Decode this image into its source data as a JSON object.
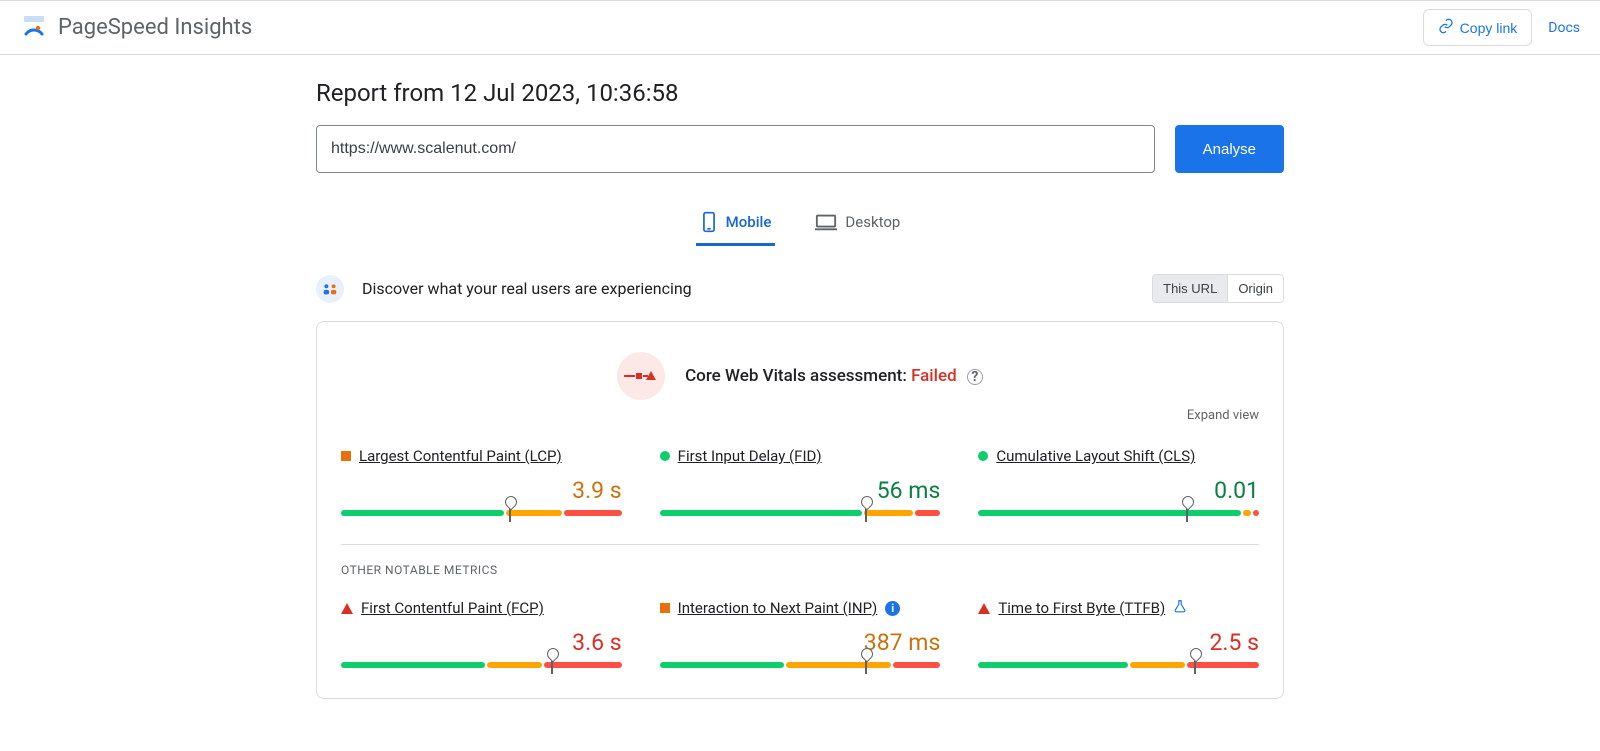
{
  "header": {
    "app_title": "PageSpeed Insights",
    "copy_link": "Copy link",
    "docs": "Docs"
  },
  "report": {
    "title": "Report from 12 Jul 2023, 10:36:58",
    "url_value": "https://www.scalenut.com/",
    "analyse_label": "Analyse"
  },
  "tabs": {
    "mobile": "Mobile",
    "desktop": "Desktop"
  },
  "discover": {
    "text": "Discover what your real users are experiencing",
    "this_url": "This URL",
    "origin": "Origin"
  },
  "assessment": {
    "label": "Core Web Vitals assessment: ",
    "status": "Failed",
    "expand": "Expand view"
  },
  "other_label": "OTHER NOTABLE METRICS",
  "metrics": {
    "lcp": {
      "name": "Largest Contentful Paint (LCP)",
      "value": "3.9 s",
      "marker": "square-orange",
      "color": "orange",
      "bars": [
        59,
        20,
        21
      ],
      "pointer": 60
    },
    "fid": {
      "name": "First Input Delay (FID)",
      "value": "56 ms",
      "marker": "circle-green",
      "color": "green",
      "bars": [
        73,
        18,
        9
      ],
      "pointer": 73
    },
    "cls": {
      "name": "Cumulative Layout Shift (CLS)",
      "value": "0.01",
      "marker": "circle-green",
      "color": "green",
      "bars": [
        95,
        3,
        2
      ],
      "pointer": 74
    },
    "fcp": {
      "name": "First Contentful Paint (FCP)",
      "value": "3.6 s",
      "marker": "triangle-red",
      "color": "red",
      "bars": [
        52,
        20,
        28
      ],
      "pointer": 75
    },
    "inp": {
      "name": "Interaction to Next Paint (INP)",
      "value": "387 ms",
      "marker": "square-orange",
      "color": "orange",
      "bars": [
        45,
        38,
        17
      ],
      "pointer": 73
    },
    "ttfb": {
      "name": "Time to First Byte (TTFB)",
      "value": "2.5 s",
      "marker": "triangle-red",
      "color": "red",
      "bars": [
        54,
        20,
        26
      ],
      "pointer": 77
    }
  }
}
